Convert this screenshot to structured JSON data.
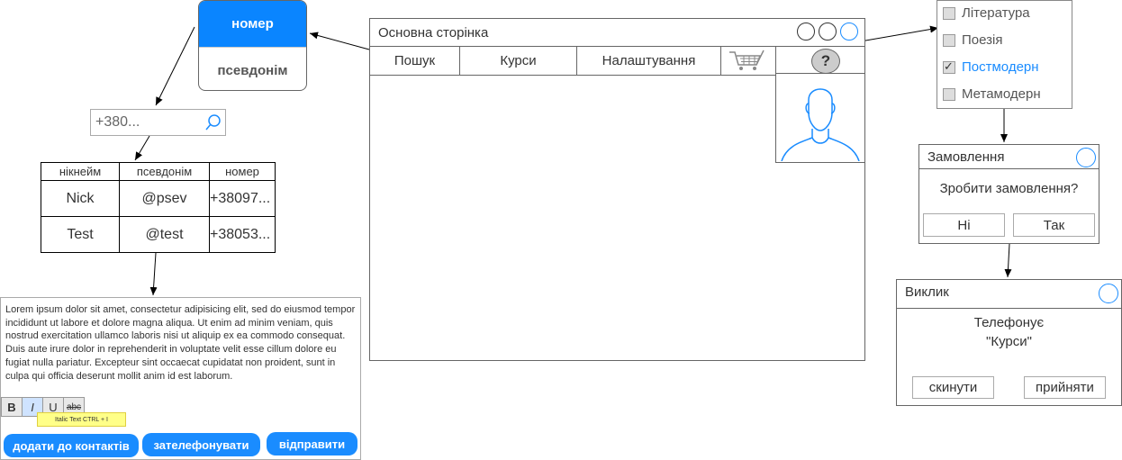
{
  "toggle": {
    "on_label": "номер",
    "off_label": "псевдонім"
  },
  "search": {
    "value": "+380..."
  },
  "table": {
    "headers": [
      "нікнейм",
      "псевдонім",
      "номер"
    ],
    "rows": [
      [
        "Nick",
        "@psev",
        "+38097..."
      ],
      [
        "Test",
        "@test",
        "+38053..."
      ]
    ]
  },
  "editor": {
    "text": "Lorem ipsum dolor sit amet, consectetur adipisicing elit, sed do eiusmod tempor incididunt ut labore et dolore magna aliqua. Ut enim ad minim veniam, quis nostrud exercitation ullamco laboris nisi ut aliquip ex ea commodo consequat. Duis aute irure dolor in reprehenderit in voluptate velit esse cillum dolore eu fugiat nulla pariatur. Excepteur sint occaecat cupidatat non proident, sunt in culpa qui officia deserunt mollit anim id est laborum.",
    "format_bold": "B",
    "format_italic": "I",
    "format_underline": "U",
    "format_strike": "abc",
    "tooltip": "Italic Text CTRL + I",
    "add_contact": "додати до контактів",
    "call": "зателефонувати",
    "send": "відправити"
  },
  "window": {
    "title": "Основна сторінка",
    "tabs": [
      "Пошук",
      "Курси",
      "Налаштування"
    ],
    "help": "?",
    "icons": [
      "cart-icon",
      "help-icon",
      "user-avatar-icon"
    ]
  },
  "checklist": [
    {
      "label": "Література",
      "checked": false
    },
    {
      "label": "Поезія",
      "checked": false
    },
    {
      "label": "Постмодерн",
      "checked": true
    },
    {
      "label": "Метамодерн",
      "checked": false
    }
  ],
  "order_dialog": {
    "title": "Замовлення",
    "message": "Зробити замовлення?",
    "no": "Ні",
    "yes": "Так"
  },
  "call_dialog": {
    "title": "Виклик",
    "message_line1": "Телефонує",
    "message_line2": "\"Курси\"",
    "reject": "скинути",
    "accept": "прийняти"
  },
  "colors": {
    "accent": "#1a8cff",
    "toggle_on": "#0a85ff",
    "tooltip": "#ffff88"
  }
}
